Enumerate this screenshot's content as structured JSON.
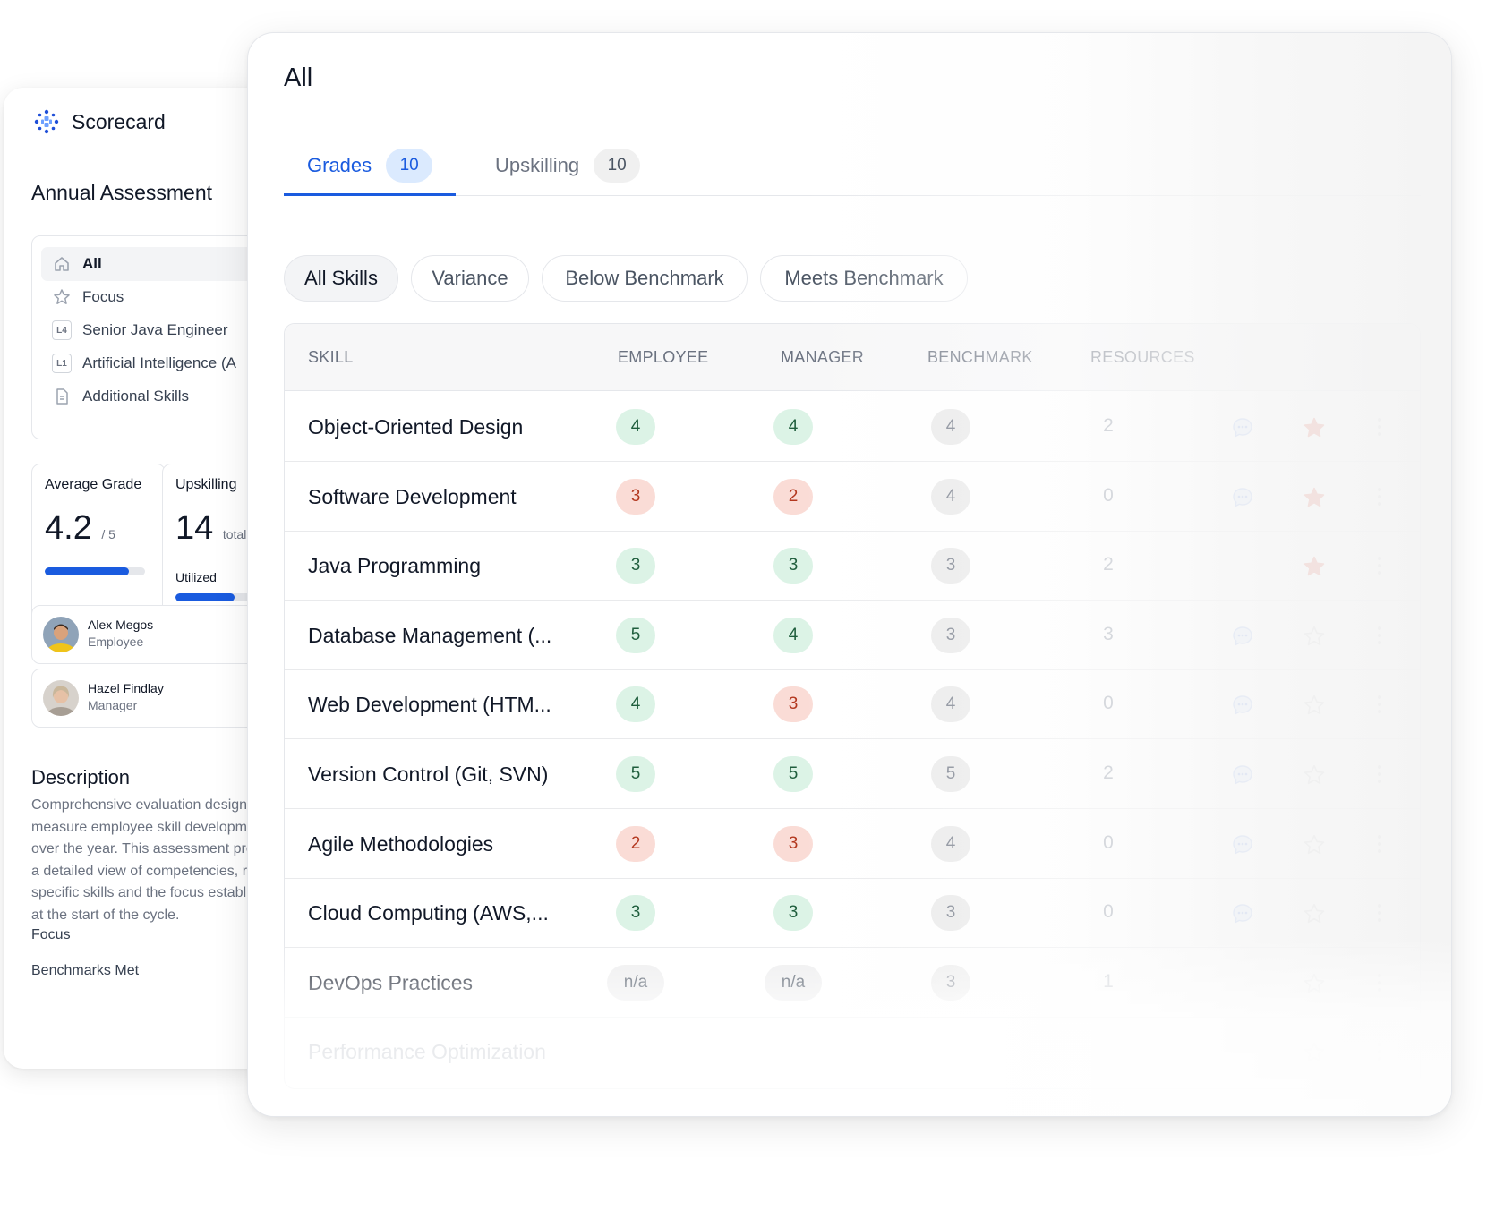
{
  "app": {
    "name": "Scorecard"
  },
  "sidebar": {
    "title": "Annual Assessment",
    "nav": [
      {
        "label": "All",
        "icon": "home-icon",
        "active": true
      },
      {
        "label": "Focus",
        "icon": "star-icon"
      },
      {
        "label": "Senior Java Engineer",
        "level": "L4"
      },
      {
        "label": "Artificial Intelligence (A",
        "level": "L1"
      },
      {
        "label": "Additional Skills",
        "icon": "document-icon"
      }
    ],
    "stats": {
      "average": {
        "title": "Average Grade",
        "value": "4.2",
        "suffix": "/ 5",
        "progress": 0.84
      },
      "upskilling": {
        "title": "Upskilling",
        "value": "14",
        "suffix": "total",
        "label": "Utilized",
        "progress": 0.55
      }
    },
    "people": [
      {
        "name": "Alex Megos",
        "role": "Employee"
      },
      {
        "name": "Hazel Findlay",
        "role": "Manager"
      }
    ],
    "description": {
      "title": "Description",
      "text": "Comprehensive evaluation designed to measure employee skill development over the year. This assessment provides a detailed view of competencies, role-specific skills and the focus established at the start of the cycle."
    },
    "meta": {
      "focus": "Focus",
      "benchmarks": "Benchmarks Met"
    }
  },
  "main": {
    "title": "All",
    "tabs": [
      {
        "label": "Grades",
        "count": "10",
        "active": true
      },
      {
        "label": "Upskilling",
        "count": "10"
      }
    ],
    "filters": [
      "All Skills",
      "Variance",
      "Below Benchmark",
      "Meets Benchmark"
    ],
    "columns": {
      "skill": "SKILL",
      "employee": "EMPLOYEE",
      "manager": "MANAGER",
      "benchmark": "BENCHMARK",
      "resources": "RESOURCES"
    },
    "rows": [
      {
        "skill": "Object-Oriented Design",
        "employee": "4",
        "manager": "4",
        "benchmark": "4",
        "resources": "2",
        "comment": true,
        "starred": true,
        "emp_status": "meets",
        "mgr_status": "meets"
      },
      {
        "skill": "Software Development",
        "employee": "3",
        "manager": "2",
        "benchmark": "4",
        "resources": "0",
        "comment": true,
        "starred": true,
        "emp_status": "below",
        "mgr_status": "below"
      },
      {
        "skill": "Java Programming",
        "employee": "3",
        "manager": "3",
        "benchmark": "3",
        "resources": "2",
        "comment": false,
        "starred": true,
        "emp_status": "meets",
        "mgr_status": "meets"
      },
      {
        "skill": "Database Management (...",
        "employee": "5",
        "manager": "4",
        "benchmark": "3",
        "resources": "3",
        "comment": true,
        "starred": false,
        "emp_status": "meets",
        "mgr_status": "meets"
      },
      {
        "skill": "Web Development (HTM...",
        "employee": "4",
        "manager": "3",
        "benchmark": "4",
        "resources": "0",
        "comment": true,
        "starred": false,
        "emp_status": "meets",
        "mgr_status": "below"
      },
      {
        "skill": "Version Control (Git, SVN)",
        "employee": "5",
        "manager": "5",
        "benchmark": "5",
        "resources": "2",
        "comment": true,
        "starred": false,
        "emp_status": "meets",
        "mgr_status": "meets"
      },
      {
        "skill": "Agile Methodologies",
        "employee": "2",
        "manager": "3",
        "benchmark": "4",
        "resources": "0",
        "comment": true,
        "starred": false,
        "emp_status": "below",
        "mgr_status": "below"
      },
      {
        "skill": "Cloud Computing (AWS,...",
        "employee": "3",
        "manager": "3",
        "benchmark": "3",
        "resources": "0",
        "comment": true,
        "starred": false,
        "emp_status": "meets",
        "mgr_status": "meets"
      },
      {
        "skill": "DevOps Practices",
        "employee": "n/a",
        "manager": "n/a",
        "benchmark": "3",
        "resources": "1",
        "comment": false,
        "starred": false,
        "emp_status": "na",
        "mgr_status": "na"
      },
      {
        "skill": "Performance Optimization",
        "employee": "",
        "manager": "",
        "benchmark": "",
        "resources": "",
        "comment": false,
        "starred": false,
        "emp_status": "none",
        "mgr_status": "none"
      }
    ]
  },
  "colors": {
    "accent": "#1a5bdf",
    "meets_bg": "#dcf3e6",
    "below_bg": "#fadcd6",
    "star": "#e0533f"
  }
}
